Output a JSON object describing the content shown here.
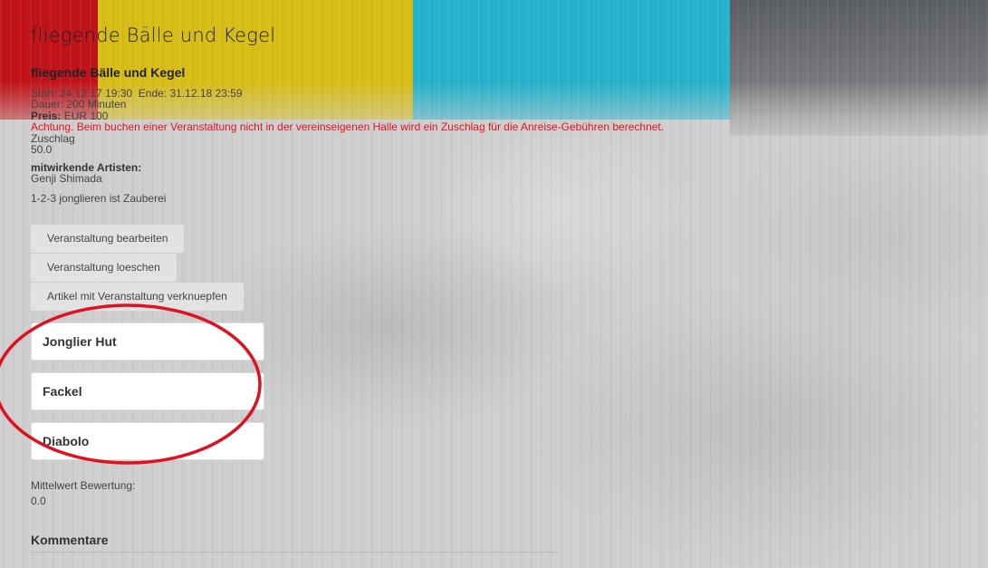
{
  "page": {
    "title": "fliegende Bälle und Kegel"
  },
  "event": {
    "name": "fliegende Bälle und Kegel",
    "start_label": "Start:",
    "start_value": "24.12.17 19:30",
    "end_label": "Ende:",
    "end_value": "31.12.18 23:59",
    "duration_label": "Dauer:",
    "duration_value": "200",
    "duration_unit": "Minuten",
    "price_label": "Preis:",
    "price_value": "EUR 100",
    "warning": "Achtung. Beim buchen einer Veranstaltung nicht in der vereinseigenen Halle wird ein Zuschlag für die Anreise-Gebühren berechnet.",
    "surcharge_label": "Zuschlag",
    "surcharge_value": "50.0",
    "artists_label": "mitwirkende Artisten:",
    "artists_value": "Genji  Shimada",
    "description": "1-2-3 jonglieren ist Zauberei"
  },
  "actions": {
    "edit": "Veranstaltung bearbeiten",
    "delete": "Veranstaltung loeschen",
    "link_articles": "Artikel mit Veranstaltung verknuepfen"
  },
  "articles": [
    "Jonglier Hut",
    "Fackel",
    "Diabolo"
  ],
  "rating": {
    "label": "Mittelwert Bewertung:",
    "value": "0.0"
  },
  "comments": {
    "heading": "Kommentare"
  },
  "colors": {
    "red": "#c0141a",
    "yellow": "#d8bd17",
    "cyan": "#25b2cc",
    "dark": "#5b5e62",
    "warning": "#e0141e",
    "annotation": "#e01020"
  }
}
